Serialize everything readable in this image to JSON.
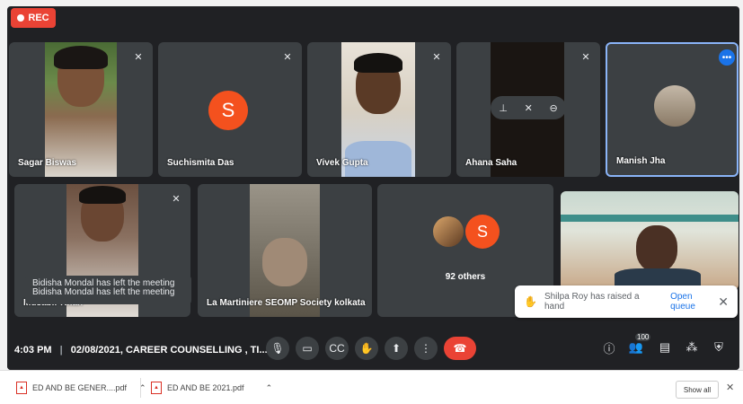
{
  "recording": {
    "label": "REC"
  },
  "participants": [
    {
      "name": "Sagar Biswas"
    },
    {
      "name": "Suchismita Das",
      "initial": "S"
    },
    {
      "name": "Vivek Gupta"
    },
    {
      "name": "Ahana Saha"
    },
    {
      "name": "Manish Jha"
    },
    {
      "name": "Mdsabir Khan"
    },
    {
      "name": "La Martiniere SEOMP Society kolkata"
    },
    {
      "name": "92 others",
      "initial": "S"
    }
  ],
  "notification": {
    "line1": "Bidisha Mondal has left the meeting",
    "line2": "Bidisha Mondal has left the meeting"
  },
  "raised_hand": {
    "text": "Shilpa Roy has raised a hand",
    "action": "Open queue"
  },
  "toolbar": {
    "time": "4:03 PM",
    "separator": "|",
    "meeting": "02/08/2021, CAREER COUNSELLING , TI...",
    "people_count": "100"
  },
  "downloads": {
    "items": [
      {
        "name": "ED AND BE GENER....pdf"
      },
      {
        "name": "ED AND BE 2021.pdf"
      }
    ],
    "show_all": "Show all"
  },
  "colors": {
    "accent_red": "#ea4335",
    "avatar_orange": "#f4511e",
    "link_blue": "#1a73e8"
  }
}
